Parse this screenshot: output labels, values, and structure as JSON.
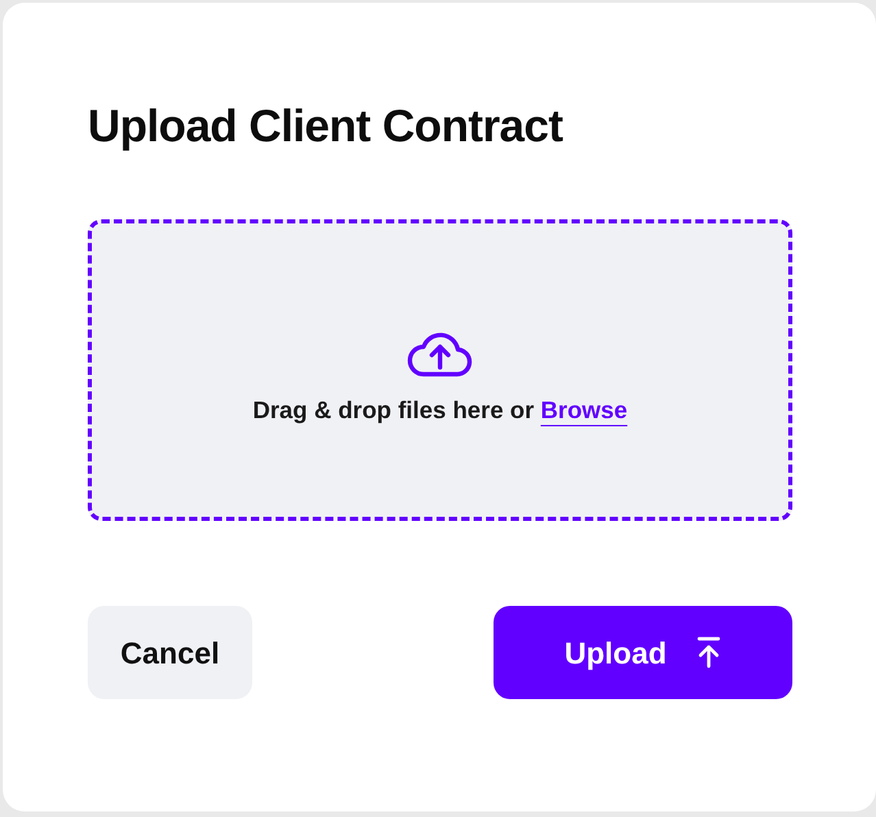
{
  "dialog": {
    "title": "Upload Client Contract"
  },
  "dropzone": {
    "text": "Drag & drop files here or ",
    "link": "Browse"
  },
  "buttons": [
    {
      "kind": "secondary",
      "label": "Cancel"
    },
    {
      "kind": "primary",
      "label": "Upload"
    }
  ]
}
